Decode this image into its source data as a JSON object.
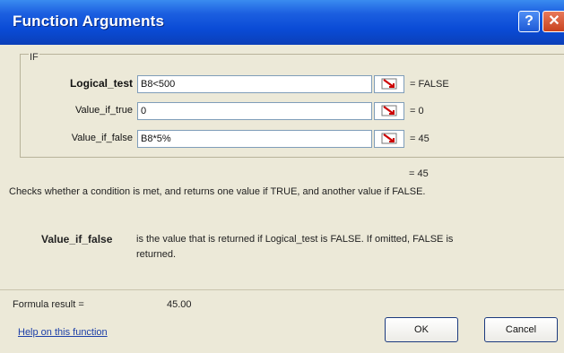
{
  "window": {
    "title": "Function Arguments",
    "help_glyph": "?",
    "close_glyph": "✕"
  },
  "function": {
    "name": "IF"
  },
  "args": [
    {
      "label": "Logical_test",
      "value": "B8<500",
      "result": "= FALSE"
    },
    {
      "label": "Value_if_true",
      "value": "0",
      "result": "= 0"
    },
    {
      "label": "Value_if_false",
      "value": "B8*5%",
      "result": "= 45"
    }
  ],
  "summary": {
    "result": "= 45",
    "description": "Checks whether a condition is met, and returns one value if TRUE, and another value if FALSE."
  },
  "arg_help": {
    "name": "Value_if_false",
    "text_line1": "is the value that is returned if Logical_test is FALSE. If omitted, FALSE is",
    "text_line2": "returned."
  },
  "formula": {
    "label": "Formula result =",
    "value": "45.00"
  },
  "footer": {
    "help_link": "Help on this function",
    "ok": "OK",
    "cancel": "Cancel"
  },
  "colors": {
    "titlebar": "#0a4bd6",
    "dialog_bg": "#ece9d8",
    "link": "#1c3fa8"
  },
  "icons": {
    "collapse": "range-collapse-icon"
  }
}
